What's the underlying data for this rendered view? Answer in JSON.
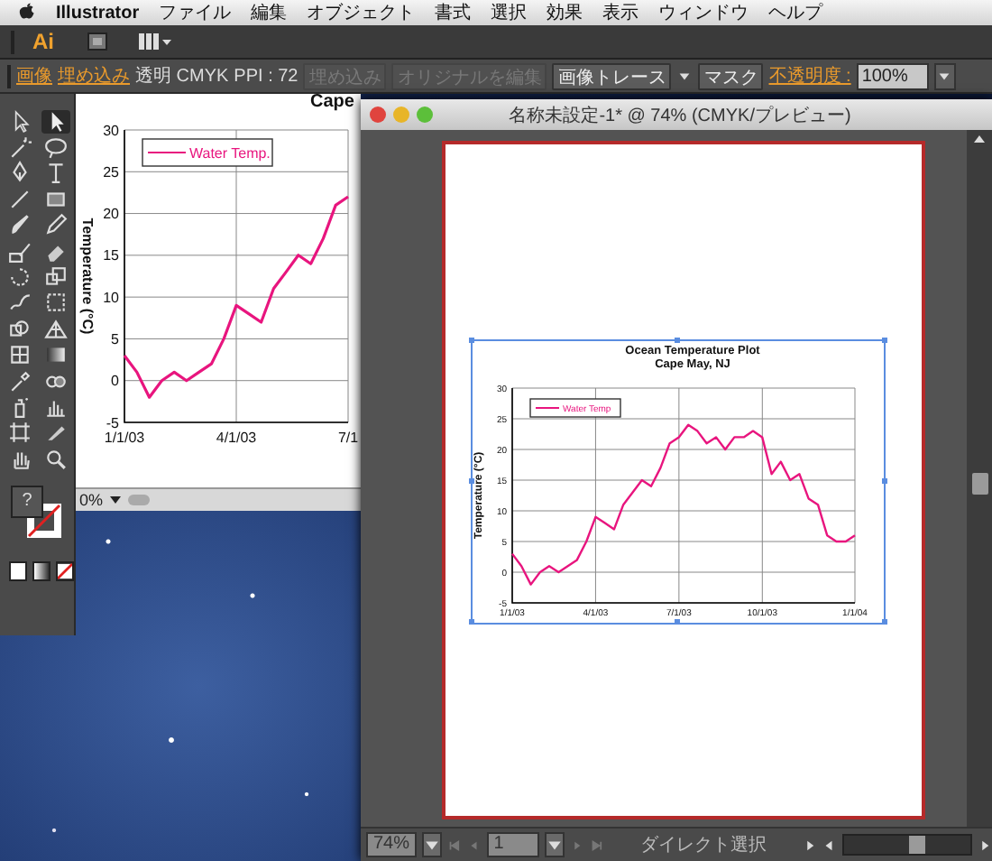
{
  "menu_bar": {
    "app_name": "Illustrator",
    "items": [
      "ファイル",
      "編集",
      "オブジェクト",
      "書式",
      "選択",
      "効果",
      "表示",
      "ウィンドウ",
      "ヘルプ"
    ]
  },
  "app_bar": {
    "logo": "Ai"
  },
  "control_bar": {
    "label": "画像",
    "embed_link": "埋め込み",
    "color_info": "透明 CMYK",
    "ppi": "PPI : 72",
    "buttons": [
      {
        "label": "埋め込み",
        "disabled": true
      },
      {
        "label": "オリジナルを編集",
        "disabled": true
      },
      {
        "label": "画像トレース",
        "disabled": false,
        "dropdown": true
      },
      {
        "label": "マスク",
        "disabled": false,
        "dropdown": false
      }
    ],
    "opacity_label": "不透明度 :",
    "opacity_value": "100%"
  },
  "tool_panel": {
    "tools": [
      {
        "kind": "selection",
        "selected": false
      },
      {
        "kind": "direct",
        "selected": true
      },
      {
        "kind": "wand",
        "selected": false
      },
      {
        "kind": "lasso",
        "selected": false
      },
      {
        "kind": "pen",
        "selected": false
      },
      {
        "kind": "type",
        "selected": false
      },
      {
        "kind": "line",
        "selected": false
      },
      {
        "kind": "rect",
        "selected": false
      },
      {
        "kind": "brush",
        "selected": false
      },
      {
        "kind": "pencil",
        "selected": false
      },
      {
        "kind": "blob",
        "selected": false
      },
      {
        "kind": "eraser",
        "selected": false
      },
      {
        "kind": "rotate",
        "selected": false
      },
      {
        "kind": "scale",
        "selected": false
      },
      {
        "kind": "warp",
        "selected": false
      },
      {
        "kind": "transform",
        "selected": false
      },
      {
        "kind": "builder",
        "selected": false
      },
      {
        "kind": "perspective",
        "selected": false
      },
      {
        "kind": "mesh",
        "selected": false
      },
      {
        "kind": "gradient",
        "selected": false
      },
      {
        "kind": "eyedropper",
        "selected": false
      },
      {
        "kind": "blend",
        "selected": false
      },
      {
        "kind": "spray",
        "selected": false
      },
      {
        "kind": "graph",
        "selected": false
      },
      {
        "kind": "artboard",
        "selected": false
      },
      {
        "kind": "knife",
        "selected": false
      },
      {
        "kind": "hand",
        "selected": false
      },
      {
        "kind": "zoom",
        "selected": false
      }
    ],
    "fill_swatch": "?"
  },
  "background_document": {
    "chart_subtitle": "Cape",
    "zoom": "0%",
    "chart_data": {
      "type": "line",
      "ylabel": "Temperature (°C)",
      "categories": [
        "1/1/03",
        null,
        null,
        null,
        null,
        null,
        null,
        null,
        null,
        "4/1/03",
        null,
        null,
        null,
        null,
        null,
        null,
        null,
        null,
        "7/1"
      ],
      "series": [
        {
          "name": "Water Temp.",
          "color": "#e8157e",
          "values": [
            3,
            1,
            -2,
            0,
            1,
            0,
            1,
            2,
            5,
            9,
            8,
            7,
            11,
            13,
            15,
            14,
            17,
            21,
            22
          ]
        }
      ],
      "ylim": [
        -5,
        30
      ],
      "yticks": [
        -5,
        0,
        5,
        10,
        15,
        20,
        25,
        30
      ],
      "grid": true
    }
  },
  "document_window": {
    "title": "名称未設定-1* @ 74% (CMYK/プレビュー)",
    "chart_subtitle": "Cape May, NJ",
    "chart_data": {
      "type": "line",
      "title": "Ocean Temperature Plot",
      "ylabel": "Temperature (°C)",
      "categories": [
        "1/1/03",
        null,
        null,
        null,
        null,
        null,
        null,
        null,
        null,
        "4/1/03",
        null,
        null,
        null,
        null,
        null,
        null,
        null,
        null,
        "7/1/03",
        null,
        null,
        null,
        null,
        null,
        null,
        null,
        null,
        "10/1/03",
        null,
        null,
        null,
        null,
        null,
        null,
        null,
        null,
        null,
        "1/1/04"
      ],
      "series": [
        {
          "name": "Water Temp",
          "color": "#e8157e",
          "values": [
            3,
            1,
            -2,
            0,
            1,
            0,
            1,
            2,
            5,
            9,
            8,
            7,
            11,
            13,
            15,
            14,
            17,
            21,
            22,
            24,
            23,
            21,
            22,
            20,
            22,
            22,
            23,
            22,
            16,
            18,
            15,
            16,
            12,
            11,
            6,
            5,
            5,
            6
          ]
        }
      ],
      "ylim": [
        -5,
        30
      ],
      "yticks": [
        -5,
        0,
        5,
        10,
        15,
        20,
        25,
        30
      ],
      "grid": true
    },
    "zoom": "74%",
    "page": "1",
    "status": "ダイレクト選択"
  }
}
